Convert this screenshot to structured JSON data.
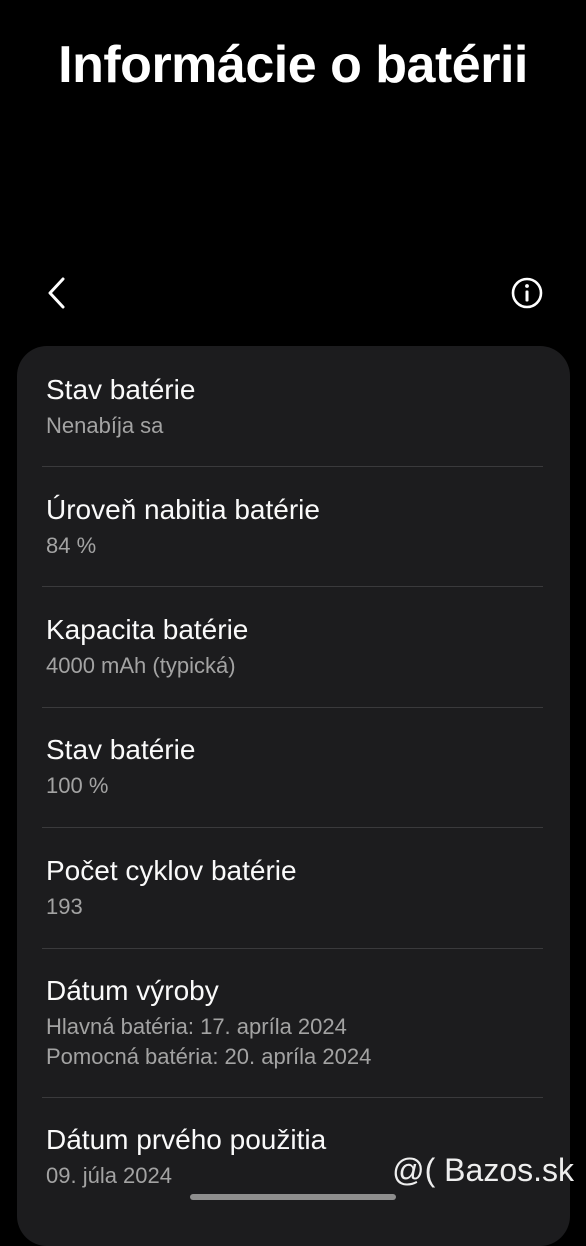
{
  "header": {
    "title": "Informácie o batérii"
  },
  "toolbar": {
    "back_icon": "chevron-left-icon",
    "info_icon": "info-circle-icon"
  },
  "battery_info": {
    "items": [
      {
        "title": "Stav batérie",
        "value": "Nenabíja sa"
      },
      {
        "title": "Úroveň nabitia batérie",
        "value": "84 %"
      },
      {
        "title": "Kapacita batérie",
        "value": "4000 mAh (typická)"
      },
      {
        "title": "Stav batérie",
        "value": "100 %"
      },
      {
        "title": "Počet cyklov batérie",
        "value": "193"
      },
      {
        "title": "Dátum výroby",
        "value": "Hlavná batéria: 17. apríla 2024",
        "value2": "Pomocná batéria: 20. apríla 2024"
      },
      {
        "title": "Dátum prvého použitia",
        "value": "09. júla 2024"
      }
    ]
  },
  "watermark": {
    "text": "@( Bazos.sk"
  },
  "colors": {
    "background": "#000000",
    "card": "#1c1c1e",
    "title_text": "#fafafa",
    "secondary_text": "#a3a3a3",
    "divider": "#3a3a3c"
  }
}
